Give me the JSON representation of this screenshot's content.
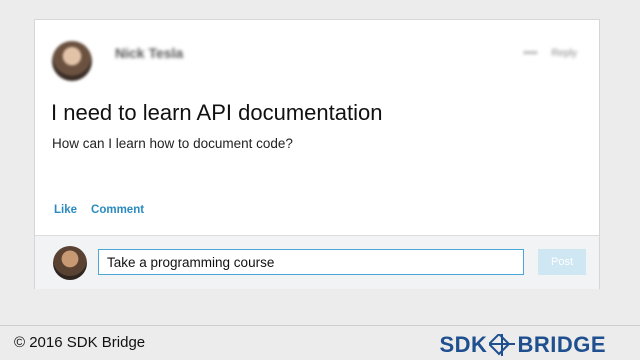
{
  "post": {
    "author": "Nick Tesla",
    "meta": [
      "••••",
      "Reply"
    ],
    "title": "I need to learn API documentation",
    "question": "How can I learn how to document code?",
    "actions": [
      "Like",
      "Comment"
    ]
  },
  "reply": {
    "input_value": "Take a programming course",
    "post_label": "Post"
  },
  "footer": {
    "copyright": "© 2016 SDK Bridge",
    "logo_left": "SDK",
    "logo_right": "BRIDGE"
  },
  "colors": {
    "link": "#2b8bc1",
    "input_border": "#4aa8d8",
    "post_button": "#cfe6f3",
    "logo": "#1f4f8f"
  },
  "icons": [
    "avatar",
    "reply-avatar",
    "bridge-logo-icon"
  ]
}
